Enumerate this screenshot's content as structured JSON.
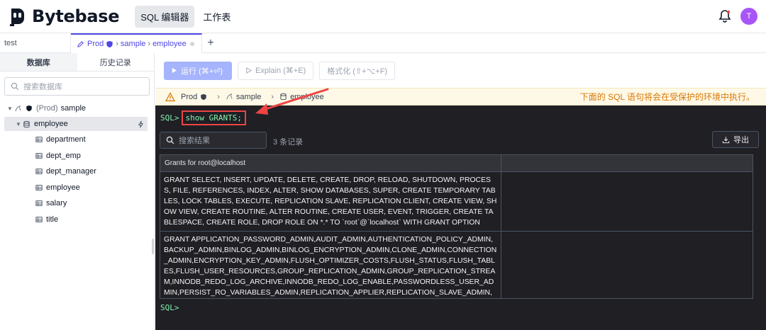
{
  "app": {
    "logo_text": "Bytebase",
    "nav": [
      {
        "label": "SQL 编辑器",
        "active": true
      },
      {
        "label": "工作表",
        "active": false
      }
    ],
    "avatar_initial": "T",
    "accent": "#4f46e5",
    "avatar_color": "#a855f7"
  },
  "tabs": {
    "first": "test",
    "active": {
      "env": "Prod",
      "db": "sample",
      "table": "employee"
    },
    "add_label": "+"
  },
  "sidebar": {
    "tabs": [
      {
        "label": "数据库",
        "active": true
      },
      {
        "label": "历史记录",
        "active": false
      }
    ],
    "search_placeholder": "搜索数据库",
    "tree": {
      "root": {
        "env": "(Prod)",
        "name": "sample"
      },
      "database": "employee",
      "tables": [
        "department",
        "dept_emp",
        "dept_manager",
        "employee",
        "salary",
        "title"
      ]
    }
  },
  "toolbar": {
    "run": "运行 (⌘+⏎)",
    "explain": "Explain (⌘+E)",
    "format": "格式化 (⇧+⌥+F)"
  },
  "warnbar": {
    "env": "Prod",
    "db": "sample",
    "table": "employee",
    "message": "下面的 SQL 语句将会在受保护的环境中执行。"
  },
  "console": {
    "prompt": "SQL>",
    "command": "show GRANTS;",
    "search_placeholder": "搜索结果",
    "count": "3 条记录",
    "export": "导出",
    "column": "Grants for root@localhost",
    "rows": [
      "GRANT SELECT, INSERT, UPDATE, DELETE, CREATE, DROP, RELOAD, SHUTDOWN, PROCESS, FILE, REFERENCES, INDEX, ALTER, SHOW DATABASES, SUPER, CREATE TEMPORARY TABLES, LOCK TABLES, EXECUTE, REPLICATION SLAVE, REPLICATION CLIENT, CREATE VIEW, SHOW VIEW, CREATE ROUTINE, ALTER ROUTINE, CREATE USER, EVENT, TRIGGER, CREATE TABLESPACE, CREATE ROLE, DROP ROLE ON *.* TO `root`@`localhost` WITH GRANT OPTION",
      "GRANT APPLICATION_PASSWORD_ADMIN,AUDIT_ADMIN,AUTHENTICATION_POLICY_ADMIN,BACKUP_ADMIN,BINLOG_ADMIN,BINLOG_ENCRYPTION_ADMIN,CLONE_ADMIN,CONNECTION_ADMIN,ENCRYPTION_KEY_ADMIN,FLUSH_OPTIMIZER_COSTS,FLUSH_STATUS,FLUSH_TABLES,FLUSH_USER_RESOURCES,GROUP_REPLICATION_ADMIN,GROUP_REPLICATION_STREAM,INNODB_REDO_LOG_ARCHIVE,INNODB_REDO_LOG_ENABLE,PASSWORDLESS_USER_ADMIN,PERSIST_RO_VARIABLES_ADMIN,REPLICATION_APPLIER,REPLICATION_SLAVE_ADMIN,RESOURCE_GROUP_ADMIN"
    ],
    "prompt_next": "SQL>"
  }
}
